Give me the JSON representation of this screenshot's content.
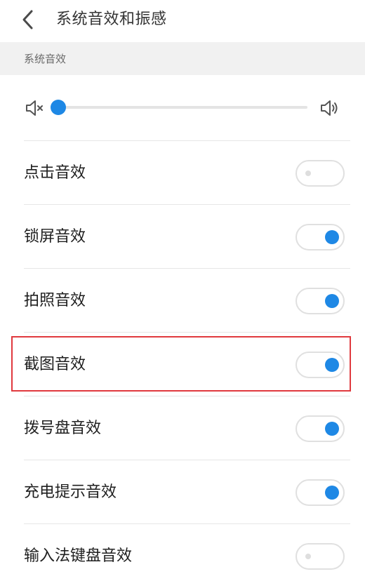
{
  "header": {
    "title": "系统音效和振感",
    "back_icon": "chevron-left-icon"
  },
  "section": {
    "title": "系统音效"
  },
  "volume": {
    "mute_icon": "volume-mute-icon",
    "loud_icon": "volume-up-icon",
    "level": 0
  },
  "settings": [
    {
      "label": "点击音效",
      "enabled": false
    },
    {
      "label": "锁屏音效",
      "enabled": true
    },
    {
      "label": "拍照音效",
      "enabled": true
    },
    {
      "label": "截图音效",
      "enabled": true
    },
    {
      "label": "拨号盘音效",
      "enabled": true
    },
    {
      "label": "充电提示音效",
      "enabled": true
    },
    {
      "label": "输入法键盘音效",
      "enabled": false
    }
  ],
  "colors": {
    "accent": "#1e88e5",
    "highlight": "#e0393e"
  }
}
